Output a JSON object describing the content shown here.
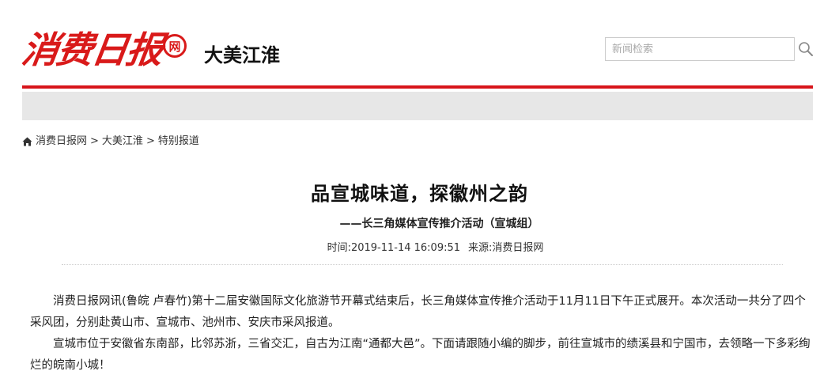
{
  "header": {
    "logo_text": "消费日报",
    "logo_badge": "网",
    "section_name": "大美江淮",
    "search_placeholder": "新闻检索"
  },
  "icons": {
    "home": "home-icon",
    "search": "search-icon"
  },
  "colors": {
    "brand_red": "#d7141a",
    "band_gray": "#e7e7e7"
  },
  "breadcrumb": {
    "items": [
      "消费日报网",
      "大美江淮",
      "特别报道"
    ],
    "separator": ">"
  },
  "article": {
    "title": "品宣城味道，探徽州之韵",
    "subtitle": "——长三角媒体宣传推介活动（宣城组）",
    "time": "时间:2019-11-14 16:09:51",
    "source": "来源:消费日报网",
    "paragraphs": [
      "消费日报网讯(鲁皖 卢春竹)第十二届安徽国际文化旅游节开幕式结束后，长三角媒体宣传推介活动于11月11日下午正式展开。本次活动一共分了四个采风团，分别赴黄山市、宣城市、池州市、安庆市采风报道。",
      "宣城市位于安徽省东南部，比邻苏浙，三省交汇，自古为江南“通都大邑”。下面请跟随小编的脚步，前往宣城市的绩溪县和宁国市，去领略一下多彩绚烂的皖南小城！"
    ]
  }
}
